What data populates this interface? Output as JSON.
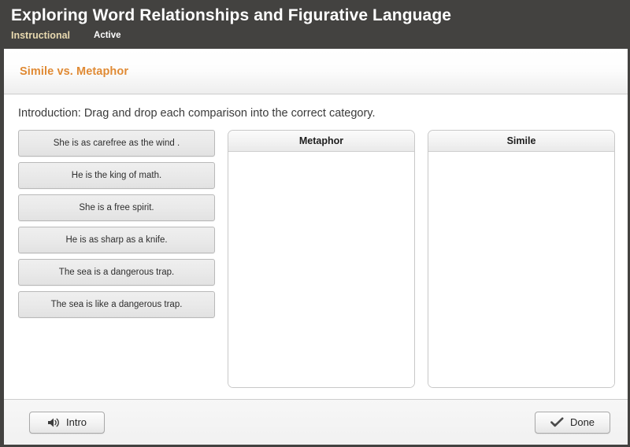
{
  "header": {
    "title": "Exploring Word Relationships and Figurative Language",
    "type_label": "Instructional",
    "state_label": "Active",
    "background_color": "#434240",
    "type_color": "#e8d9af"
  },
  "section": {
    "title": "Simile vs. Metaphor",
    "title_color": "#e08a34"
  },
  "activity": {
    "instruction": "Introduction: Drag and drop each comparison into the correct category.",
    "draggable_items": [
      {
        "text": "She is as carefree as the wind ."
      },
      {
        "text": "He is the king of math."
      },
      {
        "text": "She is a free spirit."
      },
      {
        "text": "He is as sharp as a knife."
      },
      {
        "text": "The sea is a dangerous trap."
      },
      {
        "text": "The sea is like a dangerous trap."
      }
    ],
    "drop_zones": [
      {
        "title": "Metaphor",
        "items": []
      },
      {
        "title": "Simile",
        "items": []
      }
    ]
  },
  "footer": {
    "intro_button": {
      "label": "Intro",
      "icon": "speaker-icon"
    },
    "done_button": {
      "label": "Done",
      "icon": "check-icon"
    }
  }
}
